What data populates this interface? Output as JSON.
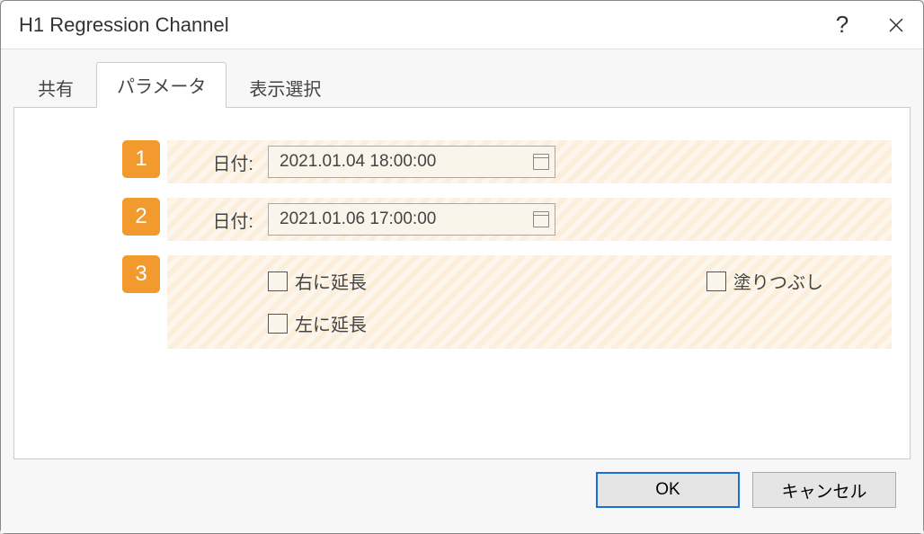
{
  "window": {
    "title": "H1 Regression Channel"
  },
  "tabs": {
    "items": [
      {
        "label": "共有",
        "active": false
      },
      {
        "label": "パラメータ",
        "active": true
      },
      {
        "label": "表示選択",
        "active": false
      }
    ]
  },
  "params": {
    "rows": [
      {
        "badge": "1",
        "label": "日付:",
        "value": "2021.01.04 18:00:00"
      },
      {
        "badge": "2",
        "label": "日付:",
        "value": "2021.01.06 17:00:00"
      }
    ],
    "row3": {
      "badge": "3",
      "extend_right": "右に延長",
      "extend_left": "左に延長",
      "fill": "塗りつぶし",
      "extend_right_checked": false,
      "extend_left_checked": false,
      "fill_checked": false
    }
  },
  "footer": {
    "ok": "OK",
    "cancel": "キャンセル"
  }
}
